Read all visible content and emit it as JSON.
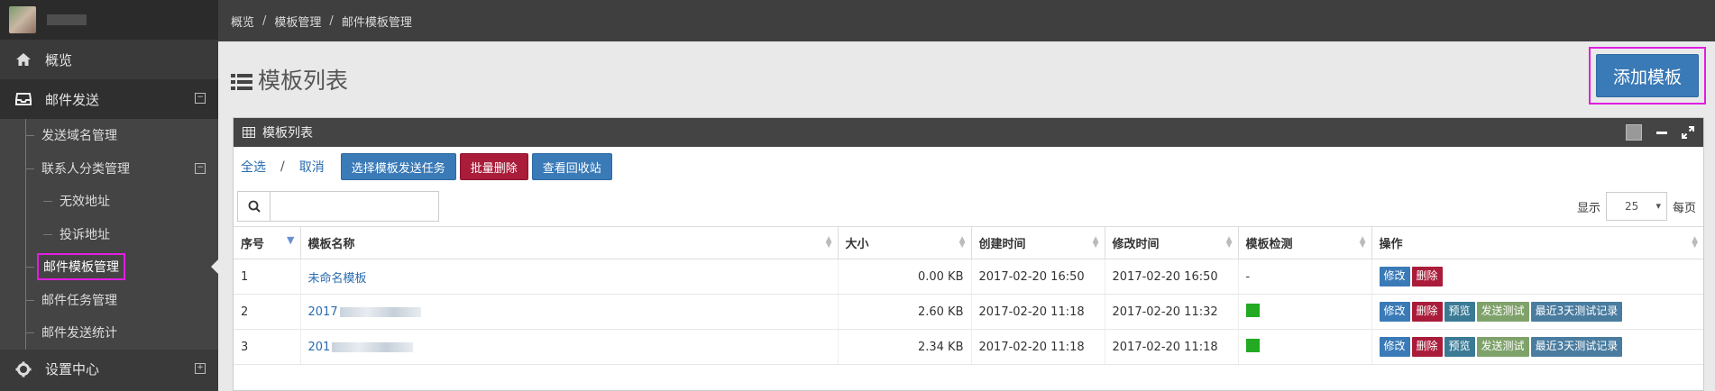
{
  "sidebar": {
    "items": [
      {
        "label": "概览",
        "icon": "home-icon"
      },
      {
        "label": "邮件发送",
        "icon": "inbox-icon",
        "toggle": "⊟"
      },
      {
        "label": "设置中心",
        "icon": "gear-icon",
        "toggle": "⊞"
      }
    ],
    "sub_items": [
      {
        "label": "发送域名管理"
      },
      {
        "label": "联系人分类管理",
        "toggle": "⊟"
      },
      {
        "label": "无效地址"
      },
      {
        "label": "投诉地址"
      },
      {
        "label": "邮件模板管理"
      },
      {
        "label": "邮件任务管理"
      },
      {
        "label": "邮件发送统计"
      }
    ]
  },
  "breadcrumb": [
    "概览",
    "模板管理",
    "邮件模板管理"
  ],
  "page": {
    "title": "模板列表",
    "add_button": "添加模板"
  },
  "box": {
    "title": "模板列表"
  },
  "actions": {
    "select_all": "全选",
    "slash": "/",
    "cancel": "取消",
    "choose_task": "选择模板发送任务",
    "batch_delete": "批量删除",
    "recycle": "查看回收站"
  },
  "search": {
    "placeholder": ""
  },
  "pager": {
    "show": "显示",
    "per_page_value": "25",
    "per_page": "每页"
  },
  "table": {
    "headers": [
      "序号",
      "模板名称",
      "大小",
      "创建时间",
      "修改时间",
      "模板检测",
      "操作"
    ],
    "rows": [
      {
        "no": "1",
        "name": "未命名模板",
        "size": "0.00 KB",
        "created": "2017-02-20 16:50",
        "modified": "2017-02-20 16:50",
        "check": "-"
      },
      {
        "no": "2",
        "name": "2017",
        "size": "2.60 KB",
        "created": "2017-02-20 11:18",
        "modified": "2017-02-20 11:32",
        "check": "green"
      },
      {
        "no": "3",
        "name": "201",
        "size": "2.34 KB",
        "created": "2017-02-20 11:18",
        "modified": "2017-02-20 11:18",
        "check": "green"
      }
    ],
    "ops": {
      "edit": "修改",
      "delete": "删除",
      "preview": "预览",
      "send_test": "发送测试",
      "recent": "最近3天测试记录"
    }
  },
  "colors": {
    "accent": "#3a7ab7",
    "danger": "#a91c3a",
    "highlight": "#e01ee0",
    "ok": "#22aa22"
  }
}
